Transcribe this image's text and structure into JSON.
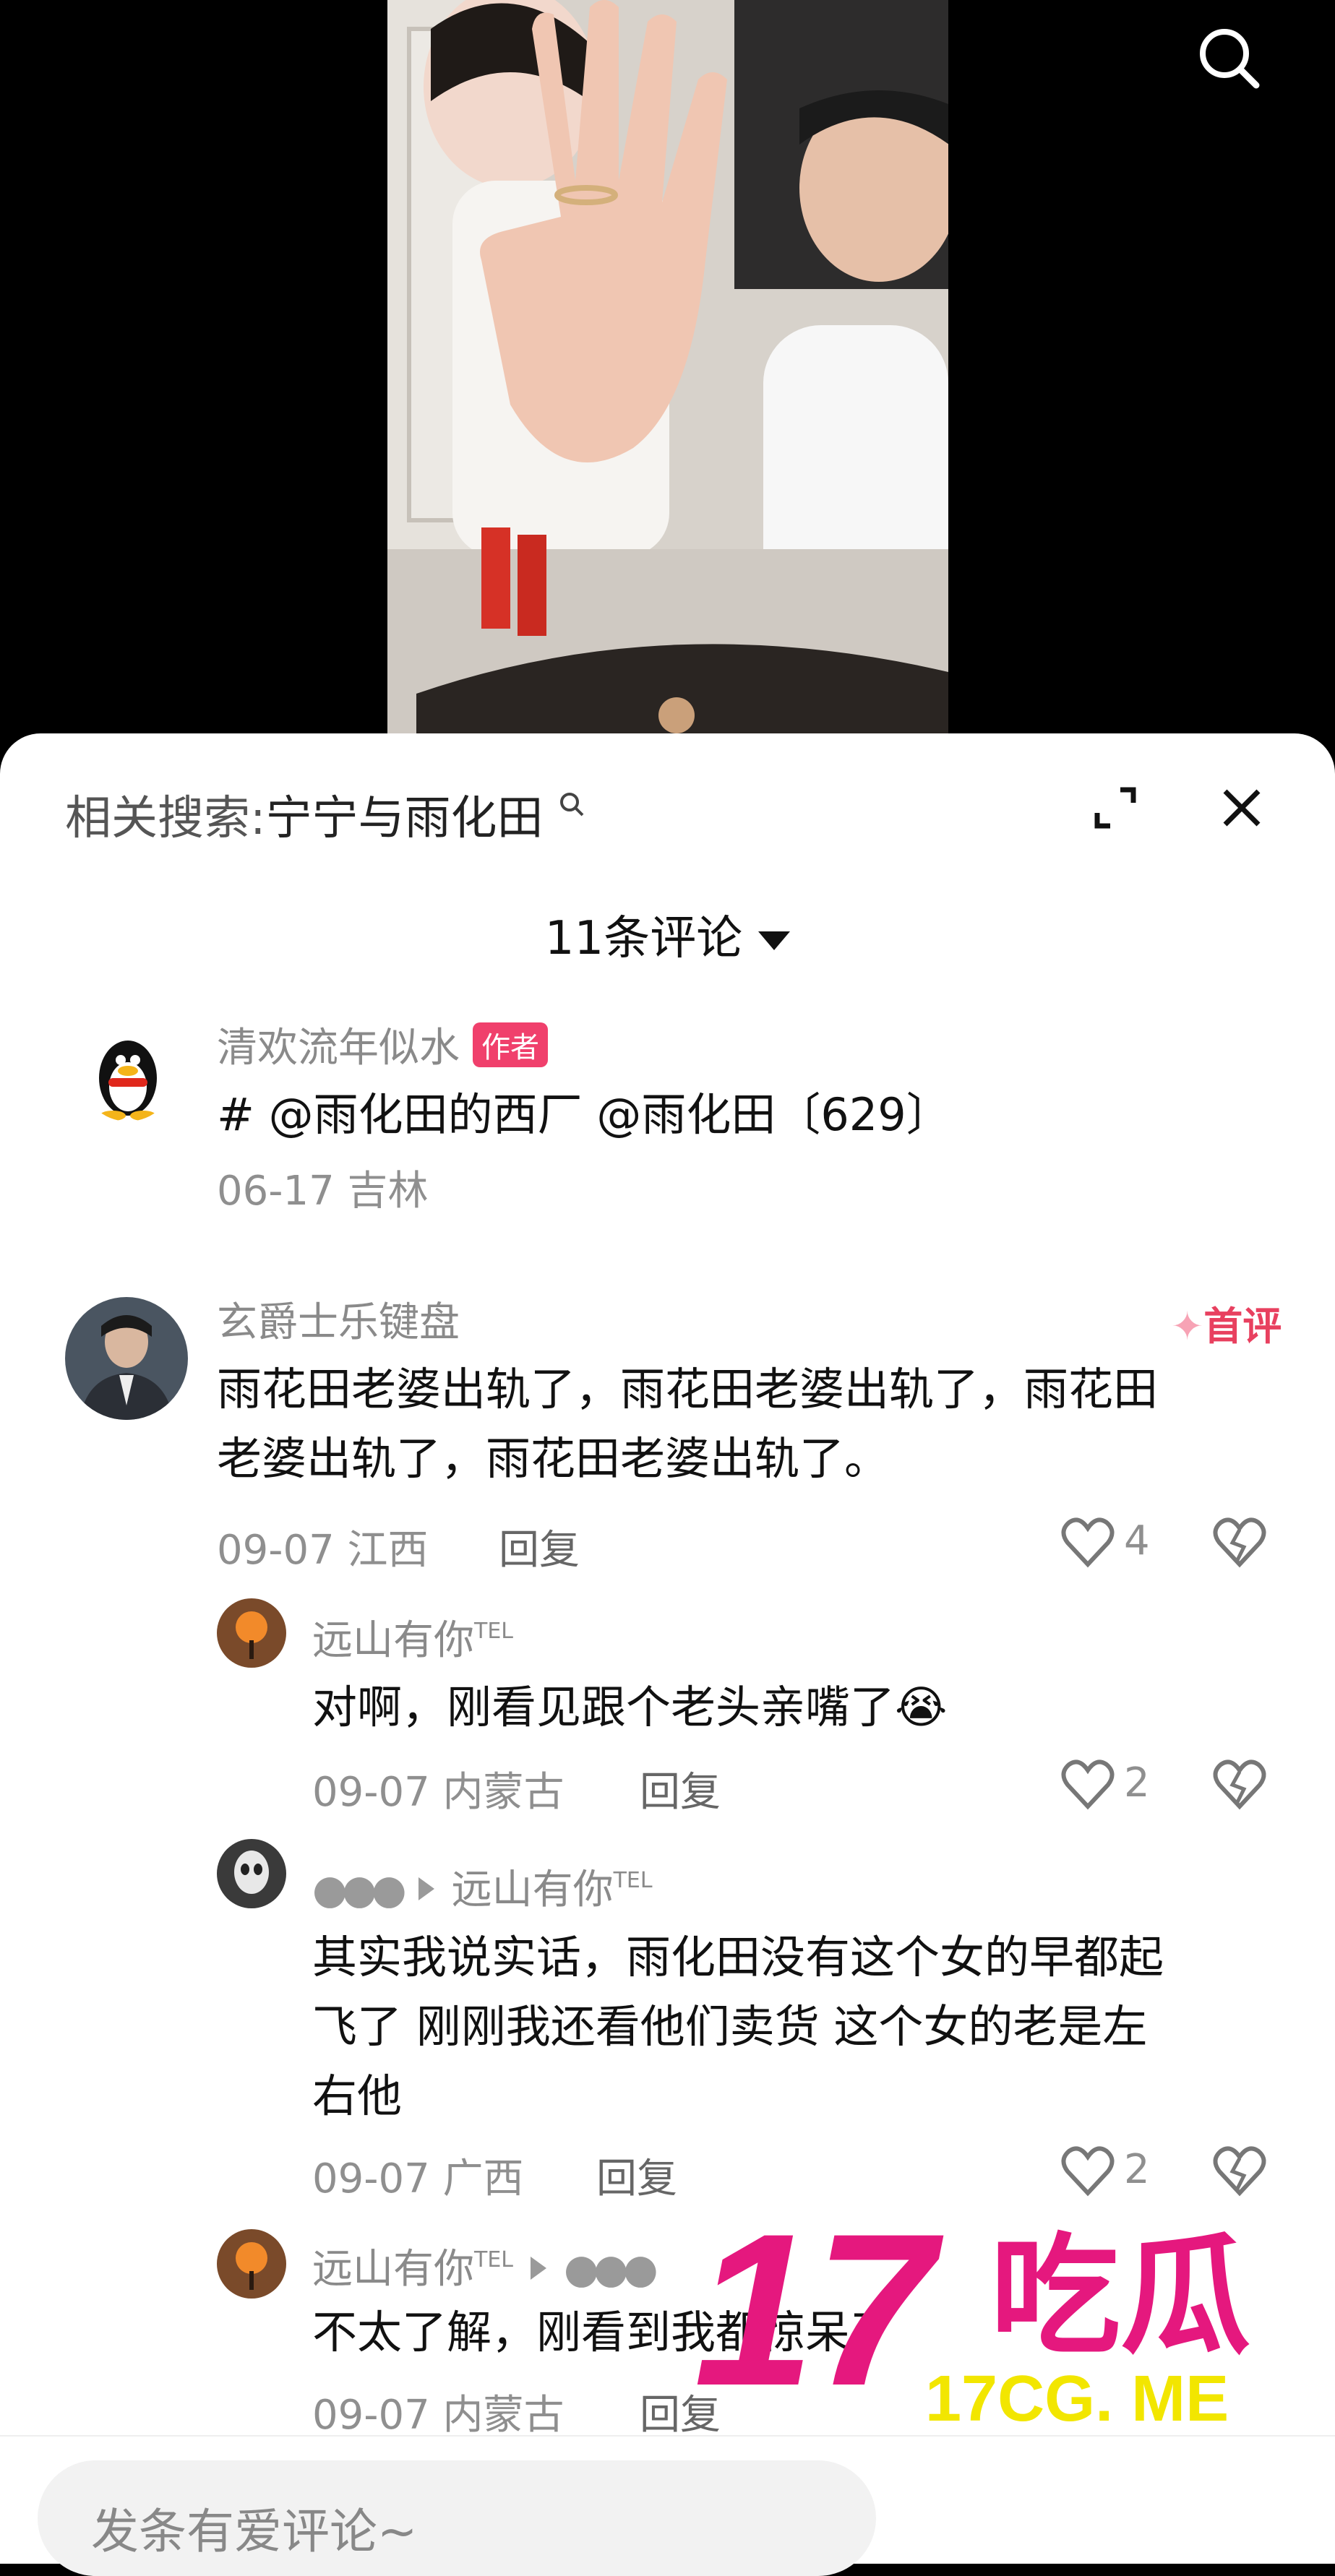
{
  "related_search": {
    "prefix": "相关搜索:",
    "keyword": "宁宁与雨化田"
  },
  "comment_count": "11条评论",
  "author_post": {
    "username": "清欢流年似水",
    "badge": "作者",
    "content": "# @雨化田的西厂 @雨化田〔629〕",
    "date_location": "06-17 吉林"
  },
  "comments": [
    {
      "username": "玄爵士乐键盘",
      "tag": "首评",
      "lines": [
        "雨花田老婆出轨了，雨花田老婆出轨了，雨花田",
        "老婆出轨了，雨花田老婆出轨了。"
      ],
      "date_location": "09-07 江西",
      "reply": "回复",
      "likes": "4"
    },
    {
      "username": "远山有你",
      "tel": "TEL",
      "content": "对啊，刚看见跟个老头亲嘴了",
      "emoji": "😭",
      "date_location": "09-07 内蒙古",
      "reply": "回复",
      "likes": "2"
    },
    {
      "username": "",
      "reply_to": "远山有你",
      "tel": "TEL",
      "lines": [
        "其实我说实话，雨化田没有这个女的早都起",
        "飞了 刚刚我还看他们卖货 这个女的老是左",
        "右他"
      ],
      "date_location": "09-07 广西",
      "reply": "回复",
      "likes": "2"
    },
    {
      "username": "远山有你",
      "tel": "TEL",
      "reply_to": "",
      "content": "不太了解，刚看到我都惊呆了",
      "date_location": "09-07 内蒙古",
      "reply": "回复"
    }
  ],
  "input_placeholder": "发条有爱评论~",
  "watermark": {
    "big": "17吃瓜",
    "small": "17CG. ME"
  }
}
